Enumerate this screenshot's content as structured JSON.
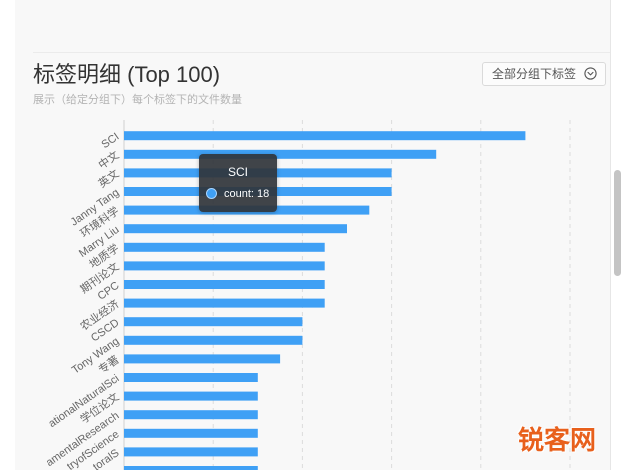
{
  "section": {
    "title": "标签明细 (Top 100)",
    "subtitle": "展示（给定分组下）每个标签下的文件数量"
  },
  "group_select": {
    "value": "全部分组下标签",
    "icon": "chevron-down-circle-icon"
  },
  "chart_data": {
    "type": "bar",
    "orientation": "horizontal",
    "categories": [
      "SCI",
      "中文",
      "英文",
      "Janny Tang",
      "环境科学",
      "Marry Liu",
      "地质学",
      "期刊论文",
      "CPC",
      "农业经济",
      "CSCD",
      "Tony Wang",
      "专著",
      "ationalNaturalSci",
      "学位论文",
      "amentalResearch",
      "tryofScience",
      "toralS",
      ""
    ],
    "values": [
      18,
      14,
      12,
      12,
      11,
      10,
      9,
      9,
      9,
      9,
      8,
      8,
      7,
      6,
      6,
      6,
      6,
      6,
      6
    ],
    "xlim": [
      0,
      20
    ],
    "grid": true,
    "grid_values": [
      4,
      8,
      12,
      16,
      20
    ],
    "color": "#3fa0f5"
  },
  "tooltip": {
    "category": "SCI",
    "label": "count: 18"
  },
  "watermark": {
    "text": "锐客网",
    "color": "#e8601c"
  }
}
